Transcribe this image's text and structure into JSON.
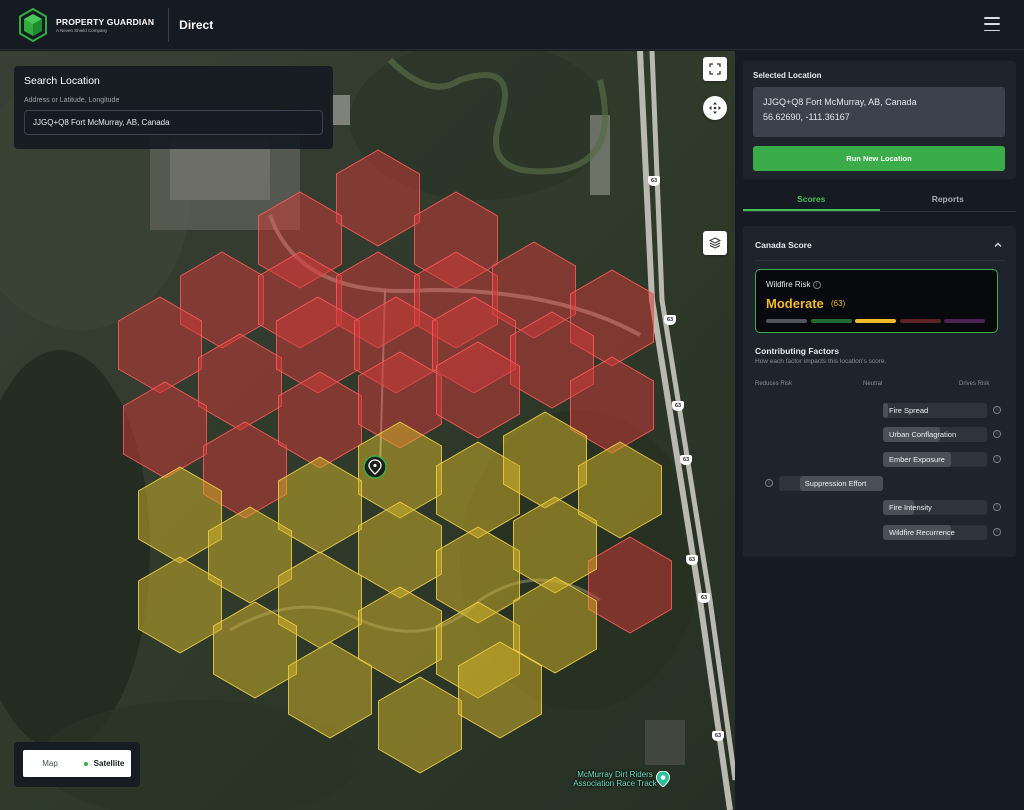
{
  "header": {
    "brand_name": "PROPERTY GUARDIAN",
    "brand_sub": "A Neven Shield Company",
    "product": "Direct",
    "menu_icon": "hamburger-menu-icon",
    "logo_color": "#2fae3f"
  },
  "search": {
    "title": "Search Location",
    "hint": "Address or Latitude, Longitude",
    "value": "JJGQ+Q8 Fort McMurray, AB, Canada"
  },
  "map": {
    "controls": [
      "fullscreen-icon",
      "pan-control-icon",
      "layers-icon"
    ],
    "map_type_options": [
      "Map",
      "Satellite"
    ],
    "map_type_selected": "Satellite",
    "road_labels": [
      "63",
      "63",
      "63",
      "63",
      "63",
      "63",
      "63"
    ],
    "poi_label": "McMurray Dirt Riders Association Race Track",
    "hex_colors": {
      "high": "#d23a3a",
      "moderate": "#d6b62a",
      "border_high": "#ff5a5a",
      "border_moderate": "#f0d04a"
    }
  },
  "selected": {
    "title": "Selected Location",
    "address": "JJGQ+Q8 Fort McMurray, AB, Canada",
    "coords": "56.62690, -111.36167",
    "run_button": "Run New Location"
  },
  "tabs": [
    {
      "label": "Scores",
      "active": true
    },
    {
      "label": "Reports",
      "active": false
    }
  ],
  "score": {
    "heading": "Canada Score",
    "risk_title": "Wildfire Risk",
    "risk_level": "Moderate",
    "risk_value": "(63)",
    "accent": "#3aad4a",
    "level_color": "#f2b928",
    "bars": [
      "#4f545d",
      "#1f6a30",
      "#f2b928",
      "#5a2424",
      "#4a2352"
    ]
  },
  "factors": {
    "title": "Contributing Factors",
    "subtitle": "How each factor impacts this location's score.",
    "axis": {
      "left": "Reduces Risk",
      "center": "Neutral",
      "right": "Drives Risk"
    },
    "items": [
      {
        "label": "Fire Spread",
        "direction": "drives",
        "magnitude": 0.05
      },
      {
        "label": "Urban Conflagration",
        "direction": "drives",
        "magnitude": 0.55
      },
      {
        "label": "Ember Exposure",
        "direction": "drives",
        "magnitude": 0.65
      },
      {
        "label": "Suppression Effort",
        "direction": "reduces",
        "magnitude": 0.8
      },
      {
        "label": "Fire Intensity",
        "direction": "drives",
        "magnitude": 0.3
      },
      {
        "label": "Wildfire Recurrence",
        "direction": "drives",
        "magnitude": 0.65
      }
    ]
  }
}
